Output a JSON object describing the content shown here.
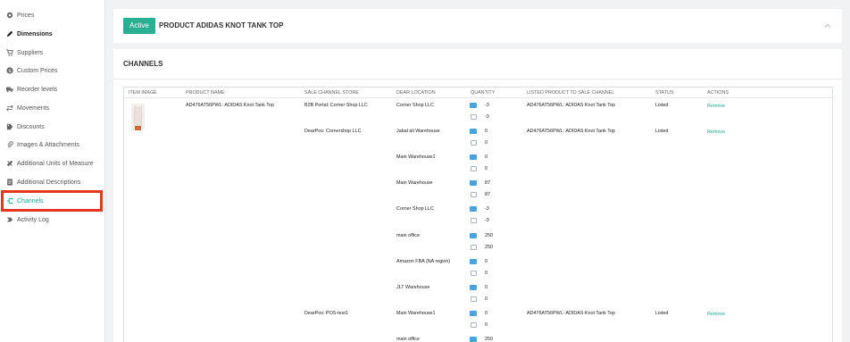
{
  "sidebar": {
    "items": [
      {
        "label": "Prices",
        "icon": "gear-icon"
      },
      {
        "label": "Dimensions",
        "icon": "pen-icon"
      },
      {
        "label": "Suppliers",
        "icon": "cart-icon"
      },
      {
        "label": "Custom Prices",
        "icon": "dollar-icon"
      },
      {
        "label": "Reorder levels",
        "icon": "truck-icon"
      },
      {
        "label": "Movements",
        "icon": "arrows-icon"
      },
      {
        "label": "Discounts",
        "icon": "tag-icon"
      },
      {
        "label": "Images & Attachments",
        "icon": "paperclip-icon"
      },
      {
        "label": "Additional Units of Measure",
        "icon": "ruler-icon"
      },
      {
        "label": "Additional Descriptions",
        "icon": "document-icon"
      },
      {
        "label": "Channels",
        "icon": "channels-icon"
      },
      {
        "label": "Activity Log",
        "icon": "log-icon"
      }
    ],
    "active": "Channels"
  },
  "header": {
    "status_badge": "Active",
    "title": "PRODUCT ADIDAS KNOT TANK TOP"
  },
  "channels": {
    "title": "CHANNELS",
    "columns": [
      "ITEM IMAGE",
      "PRODUCT NAME",
      "SALE CHANNEL STORE",
      "DEAR LOCATION",
      "QUANTITY",
      "LISTED PRODUCT TO SALE CHANNEL",
      "STATUS",
      "ACTIONS"
    ],
    "product_name": "AD476AT56PWL: ADIDAS Knot Tank Top",
    "rows": [
      {
        "store": "B2B Portal: Corner Shop LLC",
        "location": "Corner Shop LLC",
        "qty1": "-3",
        "qty2": "-3",
        "listed": "AD476AT56PWL: ADIDAS Knot Tank Top",
        "status": "Listed",
        "action": "Remove"
      },
      {
        "store": "DearPos: Cornershop LLC",
        "location": "Jabal ali Warehouse",
        "qty1": "0",
        "qty2": "0",
        "listed": "AD476AT56PWL: ADIDAS Knot Tank Top",
        "status": "Listed",
        "action": "Remove"
      },
      {
        "store": "",
        "location": "Main Warehouse1",
        "qty1": "0",
        "qty2": "0",
        "listed": "",
        "status": "",
        "action": ""
      },
      {
        "store": "",
        "location": "Main Warehouse",
        "qty1": "87",
        "qty2": "87",
        "listed": "",
        "status": "",
        "action": ""
      },
      {
        "store": "",
        "location": "Corner Shop LLC",
        "qty1": "-3",
        "qty2": "-3",
        "listed": "",
        "status": "",
        "action": ""
      },
      {
        "store": "",
        "location": "main office",
        "qty1": "250",
        "qty2": "250",
        "listed": "",
        "status": "",
        "action": ""
      },
      {
        "store": "",
        "location": "Amazon FBA (NA region)",
        "qty1": "0",
        "qty2": "0",
        "listed": "",
        "status": "",
        "action": ""
      },
      {
        "store": "",
        "location": "JLT Warehouse",
        "qty1": "0",
        "qty2": "0",
        "listed": "",
        "status": "",
        "action": ""
      },
      {
        "store": "DearPos: POS-test1",
        "location": "Main Warehouse1",
        "qty1": "0",
        "qty2": "0",
        "listed": "AD476AT56PWL: ADIDAS Knot Tank Top",
        "status": "Listed",
        "action": "Remove"
      },
      {
        "store": "",
        "location": "main office",
        "qty1": "250",
        "qty2": "",
        "listed": "",
        "status": "",
        "action": ""
      }
    ]
  },
  "colors": {
    "accent": "#29b093",
    "link": "#1fa98d",
    "highlight": "#e5361f"
  }
}
